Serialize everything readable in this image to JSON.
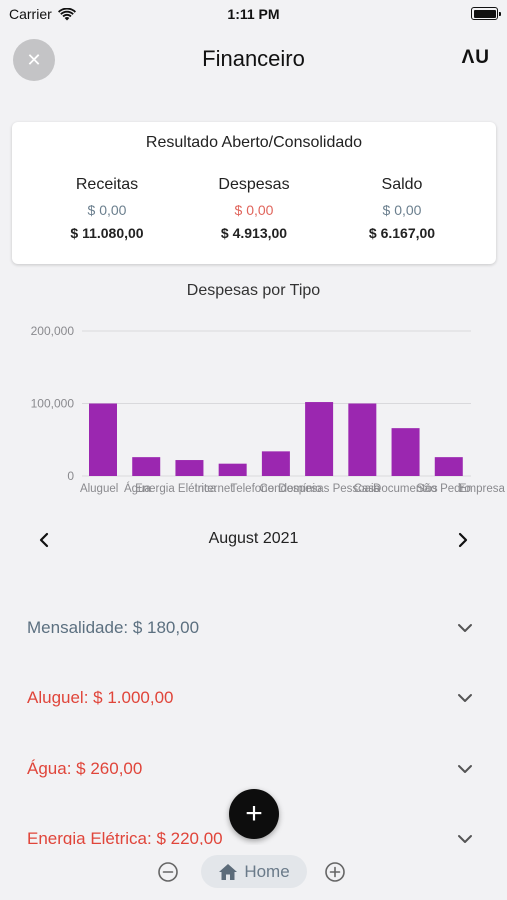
{
  "status_bar": {
    "carrier": "Carrier",
    "time": "1:11 PM",
    "wifi_icon": "wifi-icon",
    "battery_icon": "battery-icon"
  },
  "nav": {
    "title": "Financeiro",
    "logo": "ΛU",
    "close_symbol": "✕",
    "close_icon": "close-icon"
  },
  "summary": {
    "title": "Resultado Aberto/Consolidado",
    "columns": [
      {
        "label": "Receitas",
        "open": "$ 0,00",
        "total": "$ 11.080,00",
        "label_color": "#5c7080",
        "total_color": "#333333"
      },
      {
        "label": "Despesas",
        "open": "$ 0,00",
        "total": "$ 4.913,00",
        "label_color": "#e0453a",
        "total_color": "#c62a2a"
      },
      {
        "label": "Saldo",
        "open": "$ 0,00",
        "total": "$ 6.167,00",
        "label_color": "#5c7080",
        "total_color": "#333333"
      }
    ]
  },
  "chart_title": "Despesas por Tipo",
  "chart_data": {
    "type": "bar",
    "title": "Despesas por Tipo",
    "categories": [
      "Aluguel",
      "Água",
      "Energia Elétrica",
      "Internet",
      "Telefone",
      "Condomínio",
      "Despesas Pessoais",
      "Casa",
      "Documentos",
      "São Pedro",
      "Empresa"
    ],
    "values": [
      100000,
      26000,
      22000,
      17000,
      34000,
      102000,
      100000,
      66000,
      26000
    ],
    "ylim": [
      0,
      200000
    ],
    "yticks": [
      "0",
      "100,000",
      "200,000"
    ],
    "tick_values": [
      0,
      100000,
      200000
    ],
    "bar_color": "#9b27b0",
    "grid": true
  },
  "month": {
    "label": "August 2021",
    "prev_icon": "chevron-left-icon",
    "next_icon": "chevron-right-icon"
  },
  "items": [
    {
      "label": "Mensalidade: $ 180,00",
      "color": "#5c7080"
    },
    {
      "label": "Aluguel: $ 1.000,00",
      "color": "#e0453a"
    },
    {
      "label": "Água: $ 260,00",
      "color": "#e0453a"
    },
    {
      "label": "Energia Elétrica: $ 220,00",
      "color": "#e0453a"
    }
  ],
  "fab": {
    "symbol": "+",
    "icon": "plus-icon"
  },
  "bottom_bar": {
    "home_label": "Home",
    "home_icon": "home-icon",
    "zoom_out_icon": "zoom-out-icon",
    "zoom_in_icon": "zoom-in-icon"
  }
}
